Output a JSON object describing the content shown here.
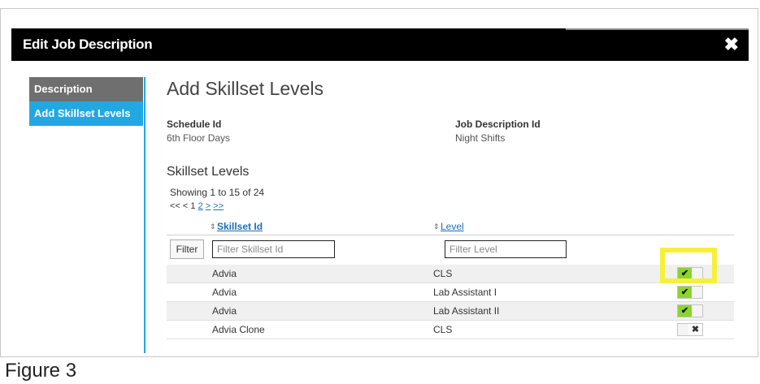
{
  "dialog": {
    "title": "Edit Job Description",
    "close_glyph": "✖"
  },
  "sidebar": {
    "items": [
      {
        "label": "Description"
      },
      {
        "label": "Add Skillset Levels"
      }
    ]
  },
  "main": {
    "heading": "Add Skillset Levels",
    "schedule_label": "Schedule Id",
    "schedule_value": "6th Floor Days",
    "jobdesc_label": "Job Description Id",
    "jobdesc_value": "Night Shifts",
    "section_title": "Skillset Levels",
    "showing": "Showing 1 to 15 of 24",
    "pager": {
      "first": "<<",
      "prev": "<",
      "current": "1",
      "page2": "2",
      "next": ">",
      "last": ">>"
    }
  },
  "table": {
    "sort_glyph": "⇕",
    "columns": {
      "skillset": "Skillset Id",
      "level": "Level"
    },
    "filter_button": "Filter",
    "filter_skillset_placeholder": "Filter Skillset Id",
    "filter_level_placeholder": "Filter Level",
    "rows": [
      {
        "skillset": "Advia",
        "level": "CLS",
        "enabled": true
      },
      {
        "skillset": "Advia",
        "level": "Lab Assistant I",
        "enabled": true
      },
      {
        "skillset": "Advia",
        "level": "Lab Assistant II",
        "enabled": true
      },
      {
        "skillset": "Advia Clone",
        "level": "CLS",
        "enabled": false
      }
    ],
    "check_glyph": "✔",
    "x_glyph": "✖"
  },
  "caption": "Figure 3",
  "colors": {
    "accent": "#21a8e3",
    "toggle_on": "#8bd42e",
    "highlight": "#f6f03b",
    "titlebar": "#000000"
  }
}
